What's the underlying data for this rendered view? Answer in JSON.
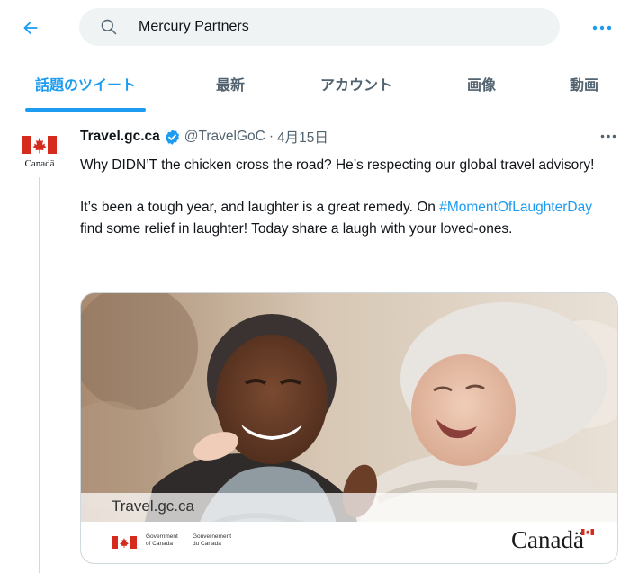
{
  "search": {
    "value": "Mercury Partners"
  },
  "tabs": [
    {
      "label": "話題のツイート",
      "active": true
    },
    {
      "label": "最新",
      "active": false
    },
    {
      "label": "アカウント",
      "active": false
    },
    {
      "label": "画像",
      "active": false
    },
    {
      "label": "動画",
      "active": false
    }
  ],
  "tweet": {
    "display_name": "Travel.gc.ca",
    "verified": true,
    "handle": "@TravelGoC",
    "separator": "·",
    "date": "4月15日",
    "avatar_wordmark": "Canadä",
    "text_p1": "Why DIDN’T the chicken cross the road? He’s respecting our global travel advisory!",
    "text_p2_before": "It’s been a tough year, and laughter is a great remedy. On ",
    "hashtag": "#MomentOfLaughterDay",
    "text_p2_after": " find some relief in laughter! Today share a laugh with your loved-ones.",
    "media": {
      "caption": "Travel.gc.ca",
      "govt_en_line1": "Government",
      "govt_en_line2": "of Canada",
      "govt_fr_line1": "Gouvernement",
      "govt_fr_line2": "du Canada",
      "wordmark": "Canadä"
    }
  },
  "colors": {
    "accent": "#1d9bf0",
    "text_primary": "#0f1419",
    "text_secondary": "#536471",
    "search_bg": "#eff3f4",
    "canada_red": "#d52b1e"
  },
  "icons": {
    "back": "back-arrow-icon",
    "search": "search-icon",
    "more": "more-horizontal-icon",
    "verified": "verified-badge-icon"
  }
}
